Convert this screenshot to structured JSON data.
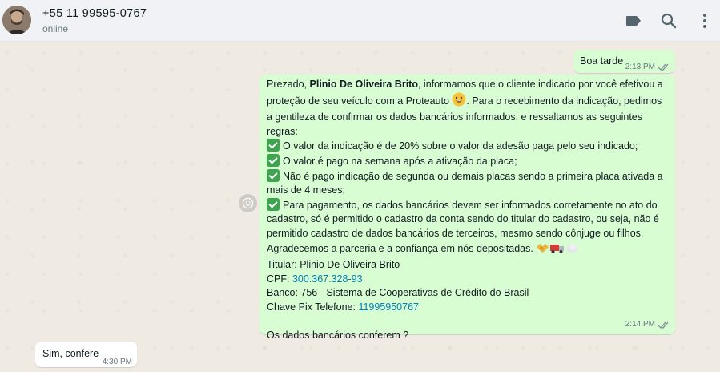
{
  "header": {
    "contact_name": "+55 11 99595-0767",
    "status": "online",
    "icons": [
      "label-icon",
      "search-icon",
      "menu-icon"
    ]
  },
  "messages": [
    {
      "direction": "outgoing",
      "text": "Boa tarde",
      "time": "2:13 PM",
      "status": "read"
    },
    {
      "direction": "outgoing",
      "intro_pre": "Prezado, ",
      "intro_name": "Plinio De Oliveira Brito",
      "intro_post": ", informamos que o cliente indicado por você efetivou a",
      "line2_pre": "proteção de seu veículo com a Proteauto ",
      "line2_post": ". Para o recebimento da indicação, pedimos",
      "line3": "a gentileza de confirmar os dados bancários informados, e  ressaltamos as seguintes",
      "line4": "regras:",
      "rule1": "O valor da indicação é de 20% sobre o valor da adesão paga pelo seu indicado;",
      "rule2": "O valor é pago na semana após a ativação da placa;",
      "rule3a": "Não é pago indicação de segunda ou demais placas sendo a primeira placa ativada a",
      "rule3b": "mais de 4 meses;",
      "rule4a": "Para pagamento, os dados bancários devem ser informados corretamente no ato do",
      "rule4b": "cadastro, só é permitido o cadastro da conta sendo do titular do cadastro, ou seja, não é",
      "rule4c": "permitido cadastro de dados bancários de terceiros, mesmo sendo cônjuge ou filhos.",
      "thanks": "Agradecemos a parceria e a confiança em nós depositadas.",
      "holder": "Titular: Plinio De Oliveira Brito",
      "cpf_label": "CPF:  ",
      "cpf_value": "300.367.328-93",
      "bank": "Banco: 756 - Sistema de Cooperativas de Crédito do Brasil",
      "pix_label": "Chave Pix Telefone: ",
      "pix_value": "11995950767",
      "question": "Os dados bancários conferem ?",
      "time": "2:14 PM",
      "status": "read"
    },
    {
      "direction": "incoming",
      "text": "Sim, confere",
      "time": "4:30 PM"
    }
  ],
  "colors": {
    "outgoing_bubble": "#d9fdd3",
    "incoming_bubble": "#ffffff",
    "chat_background": "#efeae2",
    "link": "#027eb5",
    "check_emoji": "#3fa44f"
  }
}
